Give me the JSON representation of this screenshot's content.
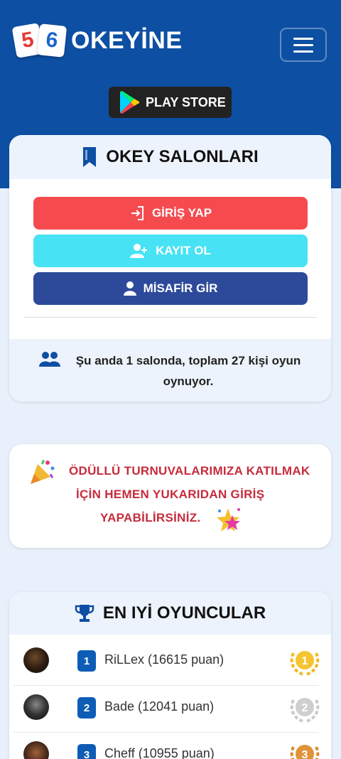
{
  "header": {
    "logo_tile_1": "5",
    "logo_tile_2": "6",
    "logo_text": "OKEYİNE",
    "menu_icon": "hamburger-icon",
    "play_store_label": "PLAY STORE"
  },
  "salons": {
    "title": "OKEY SALONLARI",
    "login_label": "GİRİŞ YAP",
    "register_label": "KAYIT OL",
    "guest_label": "MİSAFİR GİR",
    "status_text": "Şu anda 1 salonda, toplam 27 kişi oyun oynuyor."
  },
  "promo": {
    "line1": "ÖDÜLLÜ TURNUVALARIMIZA KATILMAK",
    "line2": "İÇİN HEMEN YUKARIDAN GİRİŞ",
    "line3": "YAPABİLİRSİNİZ."
  },
  "leaders": {
    "title": "EN IYİ OYUNCULAR",
    "players": [
      {
        "rank": "1",
        "name": "RiLLex (16615 puan)"
      },
      {
        "rank": "2",
        "name": "Bade (12041 puan)"
      },
      {
        "rank": "3",
        "name": "Cheff (10955 puan)"
      }
    ]
  },
  "colors": {
    "brand_blue": "#0d4fa3",
    "login": "#f54b4f",
    "register": "#48e2f5",
    "guest": "#2d4a9a",
    "promo_text": "#c62b3c"
  }
}
